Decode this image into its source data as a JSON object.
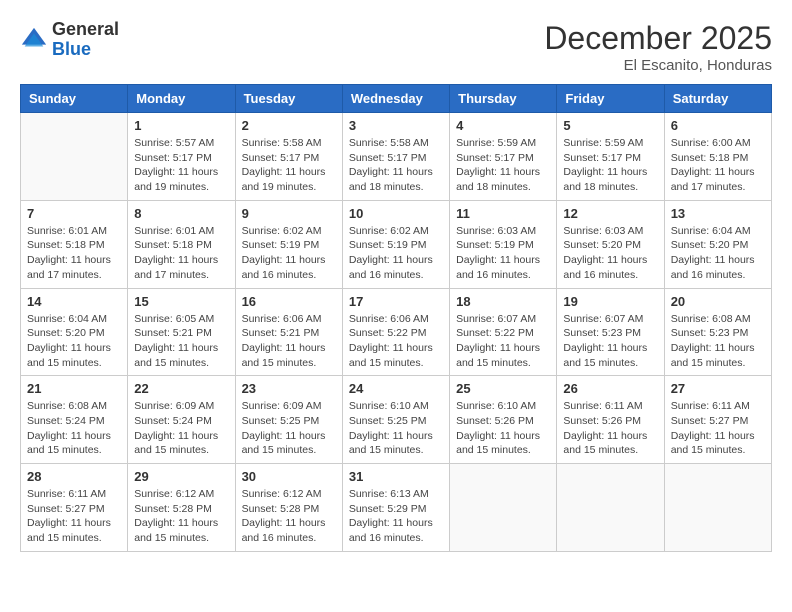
{
  "header": {
    "logo_general": "General",
    "logo_blue": "Blue",
    "month_title": "December 2025",
    "location": "El Escanito, Honduras"
  },
  "weekdays": [
    "Sunday",
    "Monday",
    "Tuesday",
    "Wednesday",
    "Thursday",
    "Friday",
    "Saturday"
  ],
  "weeks": [
    [
      {
        "day": "",
        "info": ""
      },
      {
        "day": "1",
        "info": "Sunrise: 5:57 AM\nSunset: 5:17 PM\nDaylight: 11 hours and 19 minutes."
      },
      {
        "day": "2",
        "info": "Sunrise: 5:58 AM\nSunset: 5:17 PM\nDaylight: 11 hours and 19 minutes."
      },
      {
        "day": "3",
        "info": "Sunrise: 5:58 AM\nSunset: 5:17 PM\nDaylight: 11 hours and 18 minutes."
      },
      {
        "day": "4",
        "info": "Sunrise: 5:59 AM\nSunset: 5:17 PM\nDaylight: 11 hours and 18 minutes."
      },
      {
        "day": "5",
        "info": "Sunrise: 5:59 AM\nSunset: 5:17 PM\nDaylight: 11 hours and 18 minutes."
      },
      {
        "day": "6",
        "info": "Sunrise: 6:00 AM\nSunset: 5:18 PM\nDaylight: 11 hours and 17 minutes."
      }
    ],
    [
      {
        "day": "7",
        "info": "Sunrise: 6:01 AM\nSunset: 5:18 PM\nDaylight: 11 hours and 17 minutes."
      },
      {
        "day": "8",
        "info": "Sunrise: 6:01 AM\nSunset: 5:18 PM\nDaylight: 11 hours and 17 minutes."
      },
      {
        "day": "9",
        "info": "Sunrise: 6:02 AM\nSunset: 5:19 PM\nDaylight: 11 hours and 16 minutes."
      },
      {
        "day": "10",
        "info": "Sunrise: 6:02 AM\nSunset: 5:19 PM\nDaylight: 11 hours and 16 minutes."
      },
      {
        "day": "11",
        "info": "Sunrise: 6:03 AM\nSunset: 5:19 PM\nDaylight: 11 hours and 16 minutes."
      },
      {
        "day": "12",
        "info": "Sunrise: 6:03 AM\nSunset: 5:20 PM\nDaylight: 11 hours and 16 minutes."
      },
      {
        "day": "13",
        "info": "Sunrise: 6:04 AM\nSunset: 5:20 PM\nDaylight: 11 hours and 16 minutes."
      }
    ],
    [
      {
        "day": "14",
        "info": "Sunrise: 6:04 AM\nSunset: 5:20 PM\nDaylight: 11 hours and 15 minutes."
      },
      {
        "day": "15",
        "info": "Sunrise: 6:05 AM\nSunset: 5:21 PM\nDaylight: 11 hours and 15 minutes."
      },
      {
        "day": "16",
        "info": "Sunrise: 6:06 AM\nSunset: 5:21 PM\nDaylight: 11 hours and 15 minutes."
      },
      {
        "day": "17",
        "info": "Sunrise: 6:06 AM\nSunset: 5:22 PM\nDaylight: 11 hours and 15 minutes."
      },
      {
        "day": "18",
        "info": "Sunrise: 6:07 AM\nSunset: 5:22 PM\nDaylight: 11 hours and 15 minutes."
      },
      {
        "day": "19",
        "info": "Sunrise: 6:07 AM\nSunset: 5:23 PM\nDaylight: 11 hours and 15 minutes."
      },
      {
        "day": "20",
        "info": "Sunrise: 6:08 AM\nSunset: 5:23 PM\nDaylight: 11 hours and 15 minutes."
      }
    ],
    [
      {
        "day": "21",
        "info": "Sunrise: 6:08 AM\nSunset: 5:24 PM\nDaylight: 11 hours and 15 minutes."
      },
      {
        "day": "22",
        "info": "Sunrise: 6:09 AM\nSunset: 5:24 PM\nDaylight: 11 hours and 15 minutes."
      },
      {
        "day": "23",
        "info": "Sunrise: 6:09 AM\nSunset: 5:25 PM\nDaylight: 11 hours and 15 minutes."
      },
      {
        "day": "24",
        "info": "Sunrise: 6:10 AM\nSunset: 5:25 PM\nDaylight: 11 hours and 15 minutes."
      },
      {
        "day": "25",
        "info": "Sunrise: 6:10 AM\nSunset: 5:26 PM\nDaylight: 11 hours and 15 minutes."
      },
      {
        "day": "26",
        "info": "Sunrise: 6:11 AM\nSunset: 5:26 PM\nDaylight: 11 hours and 15 minutes."
      },
      {
        "day": "27",
        "info": "Sunrise: 6:11 AM\nSunset: 5:27 PM\nDaylight: 11 hours and 15 minutes."
      }
    ],
    [
      {
        "day": "28",
        "info": "Sunrise: 6:11 AM\nSunset: 5:27 PM\nDaylight: 11 hours and 15 minutes."
      },
      {
        "day": "29",
        "info": "Sunrise: 6:12 AM\nSunset: 5:28 PM\nDaylight: 11 hours and 15 minutes."
      },
      {
        "day": "30",
        "info": "Sunrise: 6:12 AM\nSunset: 5:28 PM\nDaylight: 11 hours and 16 minutes."
      },
      {
        "day": "31",
        "info": "Sunrise: 6:13 AM\nSunset: 5:29 PM\nDaylight: 11 hours and 16 minutes."
      },
      {
        "day": "",
        "info": ""
      },
      {
        "day": "",
        "info": ""
      },
      {
        "day": "",
        "info": ""
      }
    ]
  ]
}
